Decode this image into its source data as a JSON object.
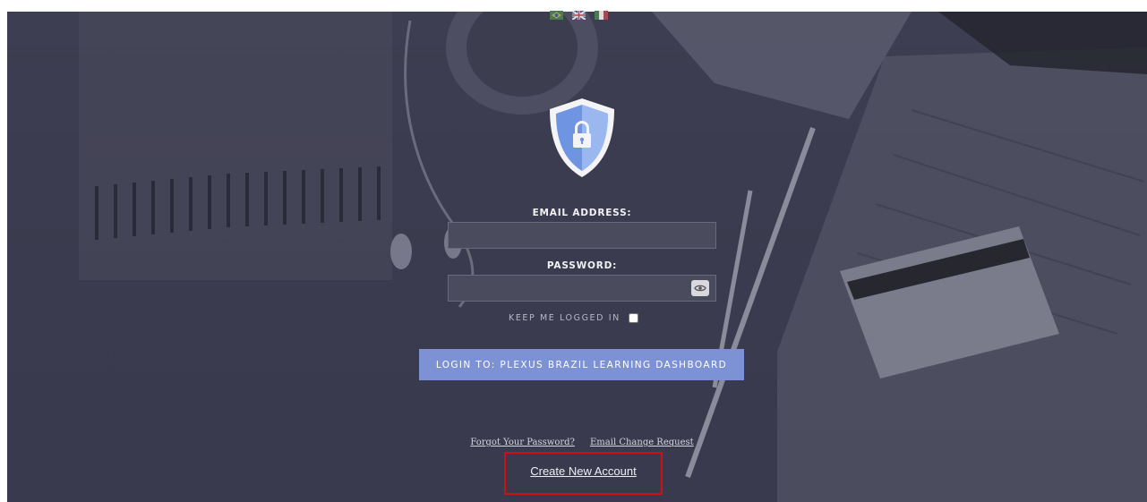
{
  "language_flags": [
    {
      "icon": "brazil-flag-icon",
      "name": "Português"
    },
    {
      "icon": "uk-flag-icon",
      "name": "English"
    },
    {
      "icon": "mexico-flag-icon",
      "name": "Español"
    }
  ],
  "logo_icon": "security-shield-lock-icon",
  "login_form": {
    "email_label": "EMAIL ADDRESS:",
    "email_value": "",
    "password_label": "PASSWORD:",
    "password_value": "",
    "show_password_icon": "eye-icon",
    "keep_logged_in_label": "KEEP ME LOGGED IN",
    "keep_logged_in_checked": false,
    "login_button_label": "LOGIN TO: PLEXUS BRAZIL LEARNING DASHBOARD"
  },
  "links": {
    "forgot_password": "Forgot Your Password?",
    "email_change_request": "Email Change Request",
    "create_account": "Create New Account"
  },
  "colors": {
    "overlay": "#3b3c4f",
    "login_button": "#7d92d4",
    "shield_blue": "#6f95e2",
    "highlight_box": "#cc1111"
  }
}
